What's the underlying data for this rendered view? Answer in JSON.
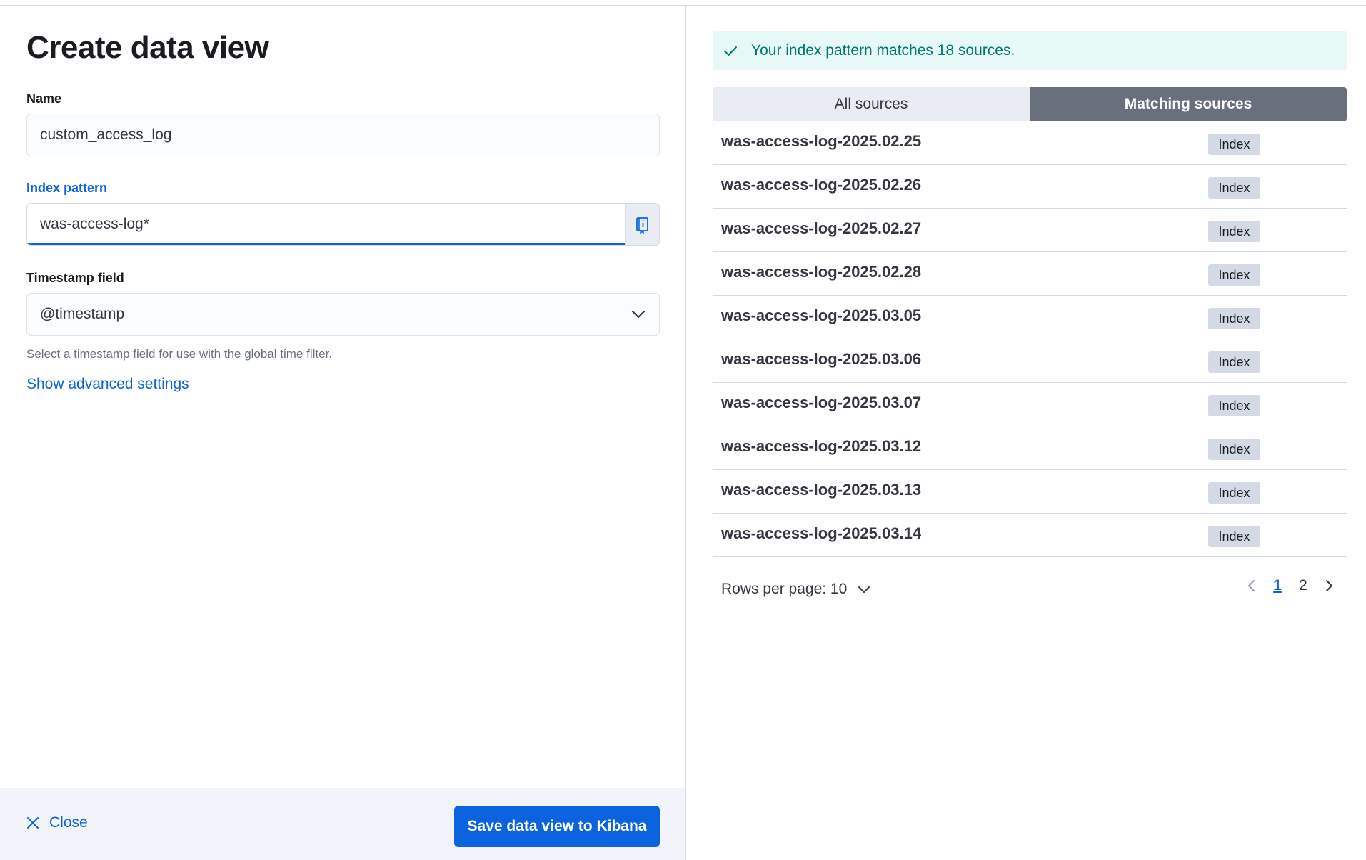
{
  "form": {
    "title": "Create data view",
    "name_label": "Name",
    "name_value": "custom_access_log",
    "index_label": "Index pattern",
    "index_value": "was-access-log*",
    "timestamp_label": "Timestamp field",
    "timestamp_value": "@timestamp",
    "timestamp_help": "Select a timestamp field for use with the global time filter.",
    "advanced_link": "Show advanced settings"
  },
  "footer": {
    "close_label": "Close",
    "save_label": "Save data view to Kibana"
  },
  "callout": {
    "message": "Your index pattern matches 18 sources.",
    "color": "#007871"
  },
  "tabs": [
    "All sources",
    "Matching sources"
  ],
  "sources": [
    {
      "name": "was-access-log-2025.02.25",
      "type": "Index"
    },
    {
      "name": "was-access-log-2025.02.26",
      "type": "Index"
    },
    {
      "name": "was-access-log-2025.02.27",
      "type": "Index"
    },
    {
      "name": "was-access-log-2025.02.28",
      "type": "Index"
    },
    {
      "name": "was-access-log-2025.03.05",
      "type": "Index"
    },
    {
      "name": "was-access-log-2025.03.06",
      "type": "Index"
    },
    {
      "name": "was-access-log-2025.03.07",
      "type": "Index"
    },
    {
      "name": "was-access-log-2025.03.12",
      "type": "Index"
    },
    {
      "name": "was-access-log-2025.03.13",
      "type": "Index"
    },
    {
      "name": "was-access-log-2025.03.14",
      "type": "Index"
    }
  ],
  "pagination": {
    "rows_per_page": "Rows per page: 10",
    "pages": [
      "1",
      "2"
    ],
    "current_page": "1"
  },
  "colors": {
    "primary": "#0b64dd",
    "success_bg": "#e6f9f7",
    "active_tab": "#69707d"
  }
}
